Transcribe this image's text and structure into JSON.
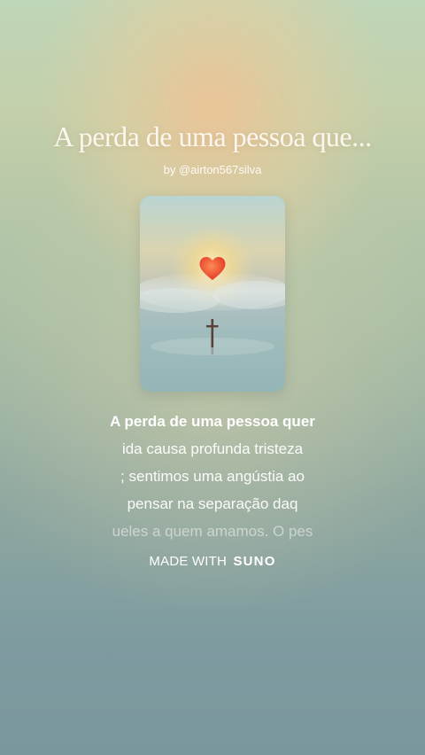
{
  "song": {
    "title": "A perda de uma pessoa que...",
    "byline": "by @airton567silva"
  },
  "cover": {
    "description_icon": "heart-cross-sunset-artwork",
    "heart_color": "#e8472e"
  },
  "lyrics": {
    "lines": [
      "A perda de uma pessoa quer",
      "ida causa profunda tristeza",
      "; sentimos uma angústia ao",
      "pensar na separação daq",
      "ueles a quem amamos. O pes"
    ]
  },
  "footer": {
    "made_with": "MADE WITH",
    "brand": "SUNO"
  }
}
